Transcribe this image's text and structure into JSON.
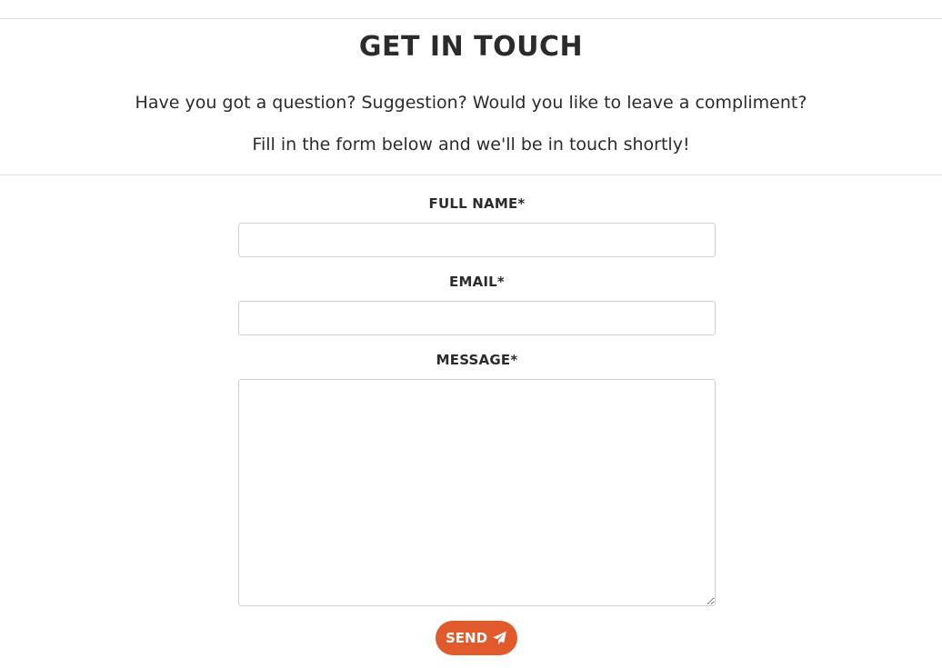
{
  "header": {
    "title": "GET IN TOUCH",
    "intro_line1": "Have you got a question? Suggestion? Would you like to leave a compliment?",
    "intro_line2": "Fill in the form below and we'll be in touch shortly!"
  },
  "form": {
    "full_name": {
      "label": "FULL NAME*",
      "value": "",
      "placeholder": ""
    },
    "email": {
      "label": "EMAIL*",
      "value": "",
      "placeholder": ""
    },
    "message": {
      "label": "MESSAGE*",
      "value": "",
      "placeholder": ""
    },
    "submit": {
      "label": "SEND",
      "icon": "paper-plane-icon"
    }
  },
  "colors": {
    "accent": "#e05a2b",
    "text": "#2b2b2b",
    "border": "#cfcfcf",
    "divider": "#e3e3e3"
  }
}
